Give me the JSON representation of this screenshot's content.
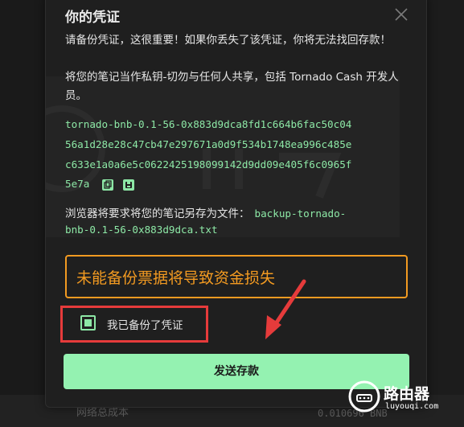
{
  "modal": {
    "title": "你的凭证",
    "intro_line1": "请备份凭证，这很重要！如果你丢失了该凭证，你将无法找回存款！",
    "intro_line2": "将您的笔记当作私钥-切勿与任何人共享，包括 Tornado Cash 开发人员。",
    "note_lines": [
      "tornado-bnb-0.1-56-0x883d9dca8fd1c664b6fac50c04",
      "56a1d28e28c47cb47e297671a0d9f534b1748ea996c485e",
      "c633e1a0a6e5c0622425198099142d9dd09e405f6c0965f",
      "5e7a"
    ],
    "save_prefix": "浏览器将要求将您的笔记另存为文件：",
    "save_filename_line1": "backup-tornado-",
    "save_filename_line2": "bnb-0.1-56-0x883d9dca.txt",
    "warning_text": "未能备份票据将导致资金损失",
    "checkbox_label": "我已备份了凭证",
    "checkbox_checked": true,
    "submit_label": "发送存款"
  },
  "background": {
    "footer_label": "网络总成本",
    "footer_value": "0.010696 BNB"
  },
  "overlay": {
    "logo_text": "路由器",
    "logo_sub": "luyouqi.com"
  },
  "colors": {
    "accent_green": "#8de8a6",
    "button_green": "#94f2b1",
    "warning_orange": "#f29a21",
    "highlight_red": "#e63b3b",
    "modal_bg": "#1f1f1f"
  },
  "icons": {
    "close": "close-icon",
    "copy": "copy-icon",
    "save": "save-icon"
  }
}
